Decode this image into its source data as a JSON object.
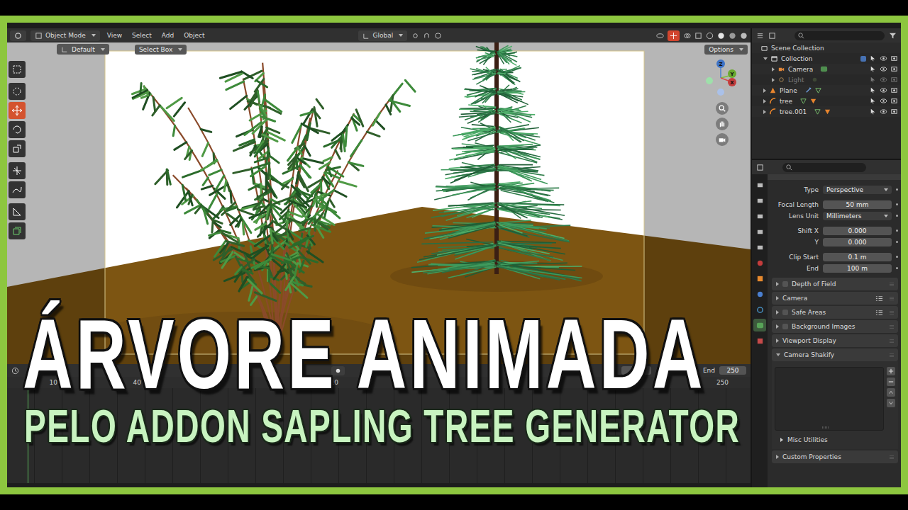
{
  "viewport_header": {
    "mode": "Object Mode",
    "menus": [
      "View",
      "Select",
      "Add",
      "Object"
    ],
    "orientation": "Global"
  },
  "tool_settings": {
    "orientation": "Default",
    "select": "Select Box",
    "options": "Options"
  },
  "toolbar": [
    {
      "kind": "select",
      "selected": false
    },
    {
      "kind": "cursor",
      "selected": false
    },
    {
      "kind": "move",
      "selected": true
    },
    {
      "kind": "rotate",
      "selected": false
    },
    {
      "kind": "scale",
      "selected": false
    },
    {
      "kind": "transform",
      "selected": false
    },
    {
      "kind": "annotate",
      "selected": false
    },
    {
      "kind": "measure",
      "selected": false
    },
    {
      "kind": "add",
      "selected": false
    }
  ],
  "gizmo": {
    "axes": [
      "Z",
      "Y",
      "X"
    ]
  },
  "outliner": {
    "rows": [
      {
        "name": "Scene Collection",
        "depth": 0,
        "kind": "scene",
        "expandable": false,
        "expanded": true,
        "muted": false
      },
      {
        "name": "Collection",
        "depth": 1,
        "kind": "collection",
        "expandable": true,
        "expanded": true,
        "muted": false
      },
      {
        "name": "Camera",
        "depth": 2,
        "kind": "camera",
        "expandable": true,
        "expanded": false,
        "muted": false
      },
      {
        "name": "Light",
        "depth": 2,
        "kind": "light",
        "expandable": true,
        "expanded": false,
        "muted": true
      },
      {
        "name": "Plane",
        "depth": 1,
        "kind": "mesh",
        "expandable": true,
        "expanded": false,
        "muted": false
      },
      {
        "name": "tree",
        "depth": 1,
        "kind": "curve",
        "expandable": true,
        "expanded": false,
        "muted": false
      },
      {
        "name": "tree.001",
        "depth": 1,
        "kind": "curve",
        "expandable": true,
        "expanded": false,
        "muted": false
      }
    ]
  },
  "properties": {
    "tabs": [
      {
        "kind": "tool",
        "selected": false
      },
      {
        "kind": "render",
        "selected": false
      },
      {
        "kind": "output",
        "selected": false
      },
      {
        "kind": "view",
        "selected": false
      },
      {
        "kind": "scene",
        "selected": false
      },
      {
        "kind": "world",
        "selected": false
      },
      {
        "kind": "object",
        "selected": false
      },
      {
        "kind": "physics",
        "selected": false
      },
      {
        "kind": "constraints",
        "selected": false
      },
      {
        "kind": "data",
        "selected": true
      },
      {
        "kind": "texture",
        "selected": false
      }
    ],
    "field_groups": [
      [
        {
          "label": "Type",
          "value": "Perspective",
          "kind": "dropdown"
        }
      ],
      [
        {
          "label": "Focal Length",
          "value": "50 mm",
          "kind": "number"
        },
        {
          "label": "Lens Unit",
          "value": "Millimeters",
          "kind": "dropdown"
        }
      ],
      [
        {
          "label": "Shift X",
          "value": "0.000",
          "kind": "number"
        },
        {
          "label": "Y",
          "value": "0.000",
          "kind": "number"
        }
      ],
      [
        {
          "label": "Clip Start",
          "value": "0.1 m",
          "kind": "number"
        },
        {
          "label": "End",
          "value": "100 m",
          "kind": "number"
        }
      ]
    ],
    "panels": [
      {
        "label": "Depth of Field",
        "checkbox": true,
        "checked": false,
        "presets": false,
        "expanded": false,
        "subpanels": []
      },
      {
        "label": "Camera",
        "checkbox": false,
        "checked": false,
        "presets": true,
        "expanded": false,
        "subpanels": []
      },
      {
        "label": "Safe Areas",
        "checkbox": true,
        "checked": false,
        "presets": true,
        "expanded": false,
        "subpanels": []
      },
      {
        "label": "Background Images",
        "checkbox": true,
        "checked": false,
        "presets": false,
        "expanded": false,
        "subpanels": []
      },
      {
        "label": "Viewport Display",
        "checkbox": false,
        "checked": false,
        "presets": false,
        "expanded": false,
        "subpanels": []
      },
      {
        "label": "Camera Shakify",
        "checkbox": false,
        "checked": false,
        "presets": false,
        "expanded": true,
        "subpanels": [
          "Misc Utilities"
        ]
      },
      {
        "label": "Custom Properties",
        "checkbox": false,
        "checked": false,
        "presets": false,
        "expanded": false,
        "subpanels": []
      }
    ]
  },
  "timeline": {
    "current_frame": "1",
    "end_label": "End",
    "end": "250",
    "ticks": [
      "10",
      "40",
      "110",
      "250"
    ]
  },
  "overlay": {
    "title": "ÁRVORE ANIMADA",
    "subtitle": "PELO ADDON SAPLING TREE GENERATOR"
  }
}
